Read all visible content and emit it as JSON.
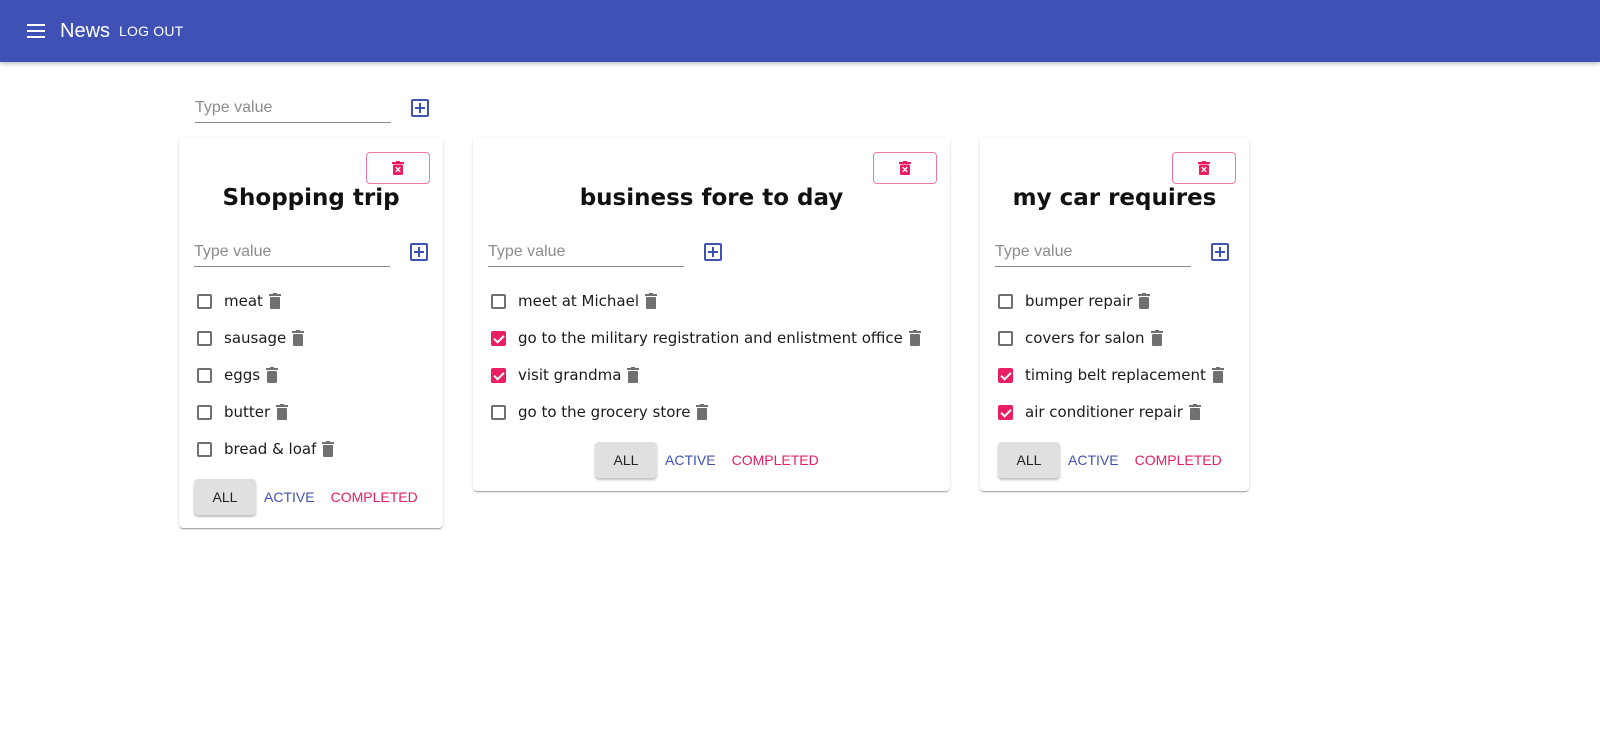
{
  "appbar": {
    "title": "News",
    "logout_label": "LOG OUT",
    "color": "#3f51b5"
  },
  "new_list": {
    "placeholder": "Type value"
  },
  "colors": {
    "primary": "#3f51b5",
    "secondary": "#e91e63",
    "icon_grey": "#707070"
  },
  "lists": [
    {
      "title": "Shopping trip",
      "placeholder": "Type value",
      "tasks": [
        {
          "text": "meat",
          "checked": false
        },
        {
          "text": "sausage",
          "checked": false
        },
        {
          "text": "eggs",
          "checked": false
        },
        {
          "text": "butter",
          "checked": false
        },
        {
          "text": "bread & loaf",
          "checked": false
        }
      ],
      "filters": {
        "all": "ALL",
        "active": "ACTIVE",
        "completed": "COMPLETED"
      }
    },
    {
      "title": "business fore to day",
      "placeholder": "Type value",
      "tasks": [
        {
          "text": "meet at Michael",
          "checked": false
        },
        {
          "text": "go to the military registration and enlistment office",
          "checked": true
        },
        {
          "text": "visit grandma",
          "checked": true
        },
        {
          "text": "go to the grocery store",
          "checked": false
        }
      ],
      "filters": {
        "all": "ALL",
        "active": "ACTIVE",
        "completed": "COMPLETED"
      }
    },
    {
      "title": "my car requires",
      "placeholder": "Type value",
      "tasks": [
        {
          "text": "bumper repair",
          "checked": false
        },
        {
          "text": "covers for salon",
          "checked": false
        },
        {
          "text": "timing belt replacement",
          "checked": true
        },
        {
          "text": "air conditioner repair",
          "checked": true
        }
      ],
      "filters": {
        "all": "ALL",
        "active": "ACTIVE",
        "completed": "COMPLETED"
      }
    }
  ]
}
